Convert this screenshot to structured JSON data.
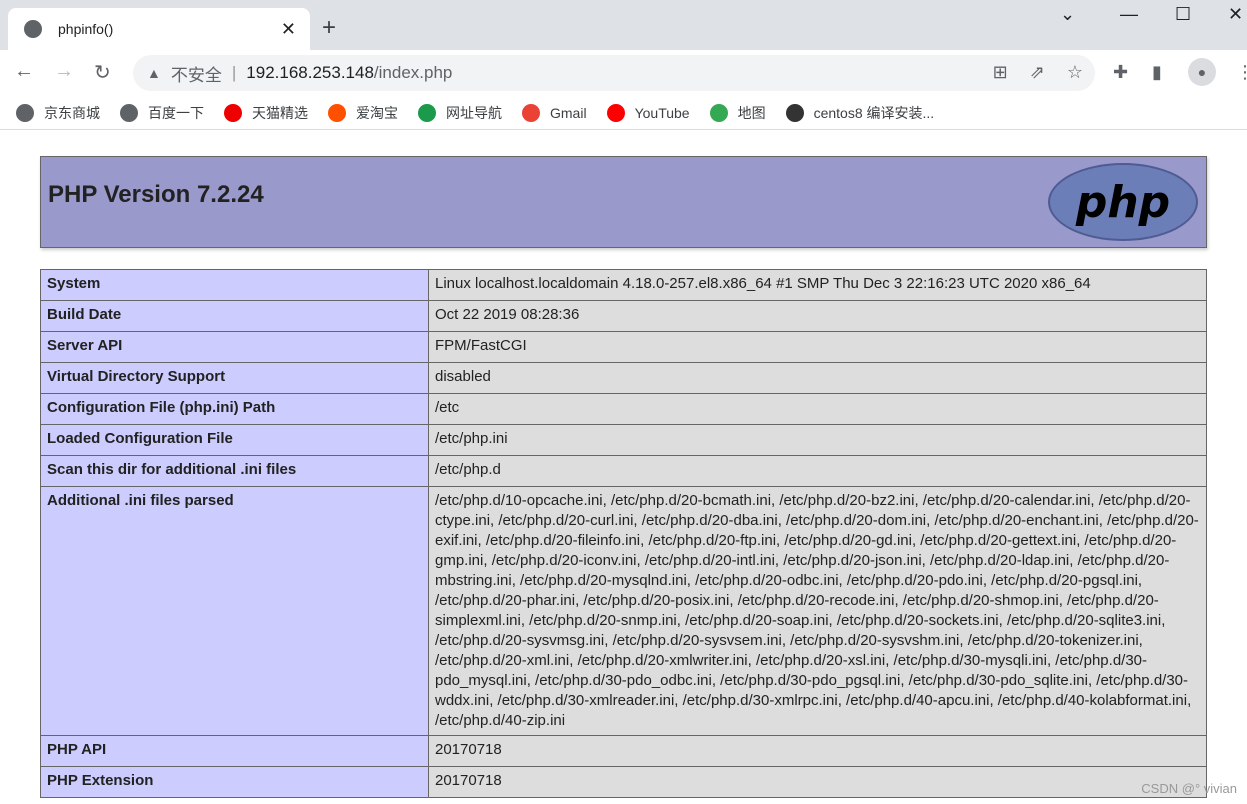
{
  "browser": {
    "tab_title": "phpinfo()",
    "url_warning": "不安全",
    "url_host": "192.168.253.148",
    "url_path": "/index.php",
    "bookmarks": [
      {
        "label": "京东商城",
        "color": "#5f6368"
      },
      {
        "label": "百度一下",
        "color": "#5f6368"
      },
      {
        "label": "天猫精选",
        "color": "#e00"
      },
      {
        "label": "爱淘宝",
        "color": "#ff5000"
      },
      {
        "label": "网址导航",
        "color": "#1a9a4a"
      },
      {
        "label": "Gmail",
        "color": "#ea4335"
      },
      {
        "label": "YouTube",
        "color": "#f00"
      },
      {
        "label": "地图",
        "color": "#34a853"
      },
      {
        "label": "centos8 编译安装...",
        "color": "#333"
      }
    ]
  },
  "php": {
    "title": "PHP Version 7.2.24",
    "logo_text": "php",
    "rows": [
      {
        "k": "System",
        "v": "Linux localhost.localdomain 4.18.0-257.el8.x86_64 #1 SMP Thu Dec 3 22:16:23 UTC 2020 x86_64"
      },
      {
        "k": "Build Date",
        "v": "Oct 22 2019 08:28:36"
      },
      {
        "k": "Server API",
        "v": "FPM/FastCGI"
      },
      {
        "k": "Virtual Directory Support",
        "v": "disabled"
      },
      {
        "k": "Configuration File (php.ini) Path",
        "v": "/etc"
      },
      {
        "k": "Loaded Configuration File",
        "v": "/etc/php.ini"
      },
      {
        "k": "Scan this dir for additional .ini files",
        "v": "/etc/php.d"
      },
      {
        "k": "Additional .ini files parsed",
        "v": "/etc/php.d/10-opcache.ini, /etc/php.d/20-bcmath.ini, /etc/php.d/20-bz2.ini, /etc/php.d/20-calendar.ini, /etc/php.d/20-ctype.ini, /etc/php.d/20-curl.ini, /etc/php.d/20-dba.ini, /etc/php.d/20-dom.ini, /etc/php.d/20-enchant.ini, /etc/php.d/20-exif.ini, /etc/php.d/20-fileinfo.ini, /etc/php.d/20-ftp.ini, /etc/php.d/20-gd.ini, /etc/php.d/20-gettext.ini, /etc/php.d/20-gmp.ini, /etc/php.d/20-iconv.ini, /etc/php.d/20-intl.ini, /etc/php.d/20-json.ini, /etc/php.d/20-ldap.ini, /etc/php.d/20-mbstring.ini, /etc/php.d/20-mysqlnd.ini, /etc/php.d/20-odbc.ini, /etc/php.d/20-pdo.ini, /etc/php.d/20-pgsql.ini, /etc/php.d/20-phar.ini, /etc/php.d/20-posix.ini, /etc/php.d/20-recode.ini, /etc/php.d/20-shmop.ini, /etc/php.d/20-simplexml.ini, /etc/php.d/20-snmp.ini, /etc/php.d/20-soap.ini, /etc/php.d/20-sockets.ini, /etc/php.d/20-sqlite3.ini, /etc/php.d/20-sysvmsg.ini, /etc/php.d/20-sysvsem.ini, /etc/php.d/20-sysvshm.ini, /etc/php.d/20-tokenizer.ini, /etc/php.d/20-xml.ini, /etc/php.d/20-xmlwriter.ini, /etc/php.d/20-xsl.ini, /etc/php.d/30-mysqli.ini, /etc/php.d/30-pdo_mysql.ini, /etc/php.d/30-pdo_odbc.ini, /etc/php.d/30-pdo_pgsql.ini, /etc/php.d/30-pdo_sqlite.ini, /etc/php.d/30-wddx.ini, /etc/php.d/30-xmlreader.ini, /etc/php.d/30-xmlrpc.ini, /etc/php.d/40-apcu.ini, /etc/php.d/40-kolabformat.ini, /etc/php.d/40-zip.ini"
      },
      {
        "k": "PHP API",
        "v": "20170718"
      },
      {
        "k": "PHP Extension",
        "v": "20170718"
      }
    ]
  },
  "watermark": "CSDN @° vivian"
}
